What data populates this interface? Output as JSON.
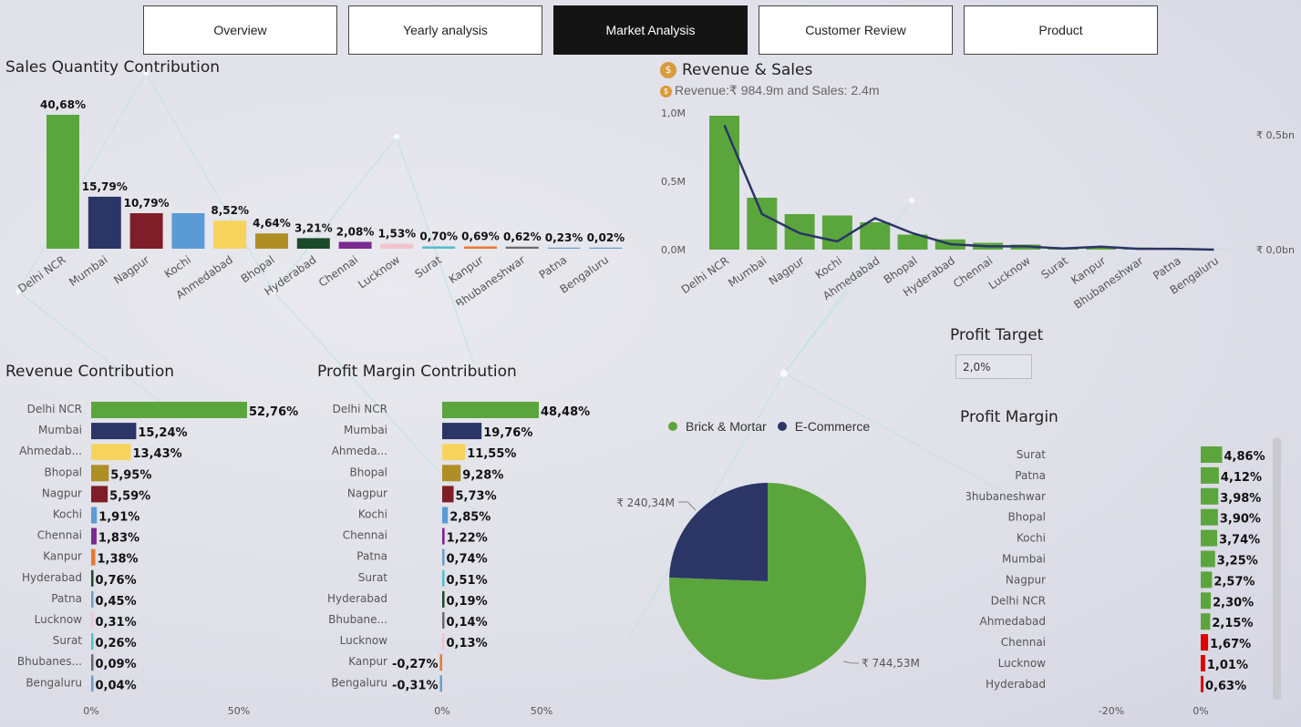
{
  "tabs": [
    {
      "label": "Overview",
      "active": false
    },
    {
      "label": "Yearly analysis",
      "active": false
    },
    {
      "label": "Market Analysis",
      "active": true
    },
    {
      "label": "Customer Review",
      "active": false
    },
    {
      "label": "Product",
      "active": false
    }
  ],
  "colors": {
    "green": "#5ba63c",
    "navy": "#2b3566",
    "maroon": "#7f1e28",
    "lightblue": "#5b9bd5",
    "yellow": "#f7d35e",
    "olive": "#b08e26",
    "darkgreen": "#1b4a2a",
    "purple": "#7a2a8f",
    "pink": "#f1c4cc",
    "teal": "#4fc0c8",
    "orange": "#e8792f",
    "gray": "#6b6b6b",
    "steel": "#6a9fc9",
    "red": "#e00000"
  },
  "text": {
    "sales_qty_title": "Sales Quantity Contribution",
    "rev_sales_title": "Revenue & Sales",
    "rev_sales_subtitle": "Revenue:₹ 984.9m and Sales: 2.4m",
    "rev_contrib_title": "Revenue Contribution",
    "pm_contrib_title": "Profit Margin Contribution",
    "profit_target_title": "Profit Target",
    "profit_target_value": "2,0%",
    "profit_margin_title": "Profit Margin",
    "legend_brick": "Brick & Mortar",
    "legend_ecom": "E-Commerce"
  },
  "icons": {
    "money": "money-bag-icon"
  },
  "chart_data": [
    {
      "id": "sales_qty",
      "type": "bar",
      "title": "Sales Quantity Contribution",
      "categories": [
        "Delhi NCR",
        "Mumbai",
        "Nagpur",
        "Kochi",
        "Ahmedabad",
        "Bhopal",
        "Hyderabad",
        "Chennai",
        "Lucknow",
        "Surat",
        "Kanpur",
        "Bhubaneshwar",
        "Patna",
        "Bengaluru"
      ],
      "values": [
        40.68,
        15.79,
        10.79,
        10.79,
        8.52,
        4.64,
        3.21,
        2.08,
        1.53,
        0.7,
        0.69,
        0.62,
        0.23,
        0.02
      ],
      "labels": [
        "40,68%",
        "15,79%",
        "10,79%",
        "",
        "8,52%",
        "4,64%",
        "3,21%",
        "2,08%",
        "1,53%",
        "0,70%",
        "0,69%",
        "0,62%",
        "0,23%",
        "0,02%"
      ],
      "colors": [
        "green",
        "navy",
        "maroon",
        "lightblue",
        "yellow",
        "olive",
        "darkgreen",
        "purple",
        "pink",
        "teal",
        "orange",
        "gray",
        "steel",
        "steel"
      ]
    },
    {
      "id": "rev_sales",
      "type": "bar",
      "title": "Revenue & Sales",
      "categories": [
        "Delhi NCR",
        "Mumbai",
        "Nagpur",
        "Kochi",
        "Ahmedabad",
        "Bhopal",
        "Hyderabad",
        "Chennai",
        "Lucknow",
        "Surat",
        "Kanpur",
        "Bhubaneshwar",
        "Patna",
        "Bengaluru"
      ],
      "series": [
        {
          "name": "Sales",
          "axis": "left",
          "values": [
            0.98,
            0.38,
            0.26,
            0.25,
            0.2,
            0.11,
            0.075,
            0.05,
            0.037,
            0.017,
            0.017,
            0.015,
            0.006,
            0.0005
          ]
        },
        {
          "name": "Revenue",
          "axis": "right",
          "type": "line",
          "values": [
            0.455,
            0.13,
            0.06,
            0.03,
            0.115,
            0.06,
            0.02,
            0.012,
            0.012,
            0.004,
            0.011,
            0.003,
            0.003,
            0.0002
          ]
        }
      ],
      "left_ticks": [
        "1,0M",
        "0,5M",
        "0,0M"
      ],
      "left_ylim": [
        0,
        1.0
      ],
      "right_ticks": [
        "₹ 0,5bn",
        "₹ 0,0bn"
      ],
      "right_ylim": [
        0,
        0.5
      ]
    },
    {
      "id": "rev_contrib",
      "type": "bar",
      "title": "Revenue Contribution",
      "categories": [
        "Delhi NCR",
        "Mumbai",
        "Ahmedab...",
        "Bhopal",
        "Nagpur",
        "Kochi",
        "Chennai",
        "Kanpur",
        "Hyderabad",
        "Patna",
        "Lucknow",
        "Surat",
        "Bhubanes...",
        "Bengaluru"
      ],
      "values": [
        52.76,
        15.24,
        13.43,
        5.95,
        5.59,
        1.91,
        1.83,
        1.38,
        0.76,
        0.45,
        0.31,
        0.26,
        0.09,
        0.04
      ],
      "labels": [
        "52,76%",
        "15,24%",
        "13,43%",
        "5,95%",
        "5,59%",
        "1,91%",
        "1,83%",
        "1,38%",
        "0,76%",
        "0,45%",
        "0,31%",
        "0,26%",
        "0,09%",
        "0,04%"
      ],
      "colors": [
        "green",
        "navy",
        "yellow",
        "olive",
        "maroon",
        "lightblue",
        "purple",
        "orange",
        "darkgreen",
        "steel",
        "pink",
        "teal",
        "gray",
        "steel"
      ],
      "x_ticks": [
        "0%",
        "50%"
      ],
      "xlim": [
        0,
        50
      ]
    },
    {
      "id": "pm_contrib",
      "type": "bar",
      "title": "Profit Margin Contribution",
      "categories": [
        "Delhi NCR",
        "Mumbai",
        "Ahmeda...",
        "Bhopal",
        "Nagpur",
        "Kochi",
        "Chennai",
        "Patna",
        "Surat",
        "Hyderabad",
        "Bhubane...",
        "Lucknow",
        "Kanpur",
        "Bengaluru"
      ],
      "values": [
        48.48,
        19.76,
        11.55,
        9.28,
        5.73,
        2.85,
        1.22,
        0.74,
        0.51,
        0.19,
        0.14,
        0.13,
        -0.27,
        -0.31
      ],
      "labels": [
        "48,48%",
        "19,76%",
        "11,55%",
        "9,28%",
        "5,73%",
        "2,85%",
        "1,22%",
        "0,74%",
        "0,51%",
        "0,19%",
        "0,14%",
        "0,13%",
        "-0,27%",
        "-0,31%"
      ],
      "colors": [
        "green",
        "navy",
        "yellow",
        "olive",
        "maroon",
        "lightblue",
        "purple",
        "steel",
        "teal",
        "darkgreen",
        "gray",
        "pink",
        "orange",
        "steel"
      ],
      "x_ticks": [
        "0%",
        "50%"
      ],
      "xlim": [
        0,
        50
      ]
    },
    {
      "id": "channel_pie",
      "type": "pie",
      "slices": [
        {
          "name": "Brick & Mortar",
          "value": 744.53,
          "label": "₹ 744,53M",
          "color": "green"
        },
        {
          "name": "E-Commerce",
          "value": 240.34,
          "label": "₹ 240,34M",
          "color": "navy"
        }
      ]
    },
    {
      "id": "profit_margin",
      "type": "bar",
      "title": "Profit Margin",
      "categories": [
        "Surat",
        "Patna",
        "Bhubaneshwar",
        "Bhopal",
        "Kochi",
        "Mumbai",
        "Nagpur",
        "Delhi NCR",
        "Ahmedabad",
        "Chennai",
        "Lucknow",
        "Hyderabad"
      ],
      "values": [
        4.86,
        4.12,
        3.98,
        3.9,
        3.74,
        3.25,
        2.57,
        2.3,
        2.15,
        1.67,
        1.01,
        0.63
      ],
      "labels": [
        "4,86%",
        "4,12%",
        "3,98%",
        "3,90%",
        "3,74%",
        "3,25%",
        "2,57%",
        "2,30%",
        "2,15%",
        "1,67%",
        "1,01%",
        "0,63%"
      ],
      "target": 2.0,
      "x_ticks": [
        "-20%",
        "0%"
      ],
      "xlim": [
        -20,
        5
      ]
    }
  ]
}
